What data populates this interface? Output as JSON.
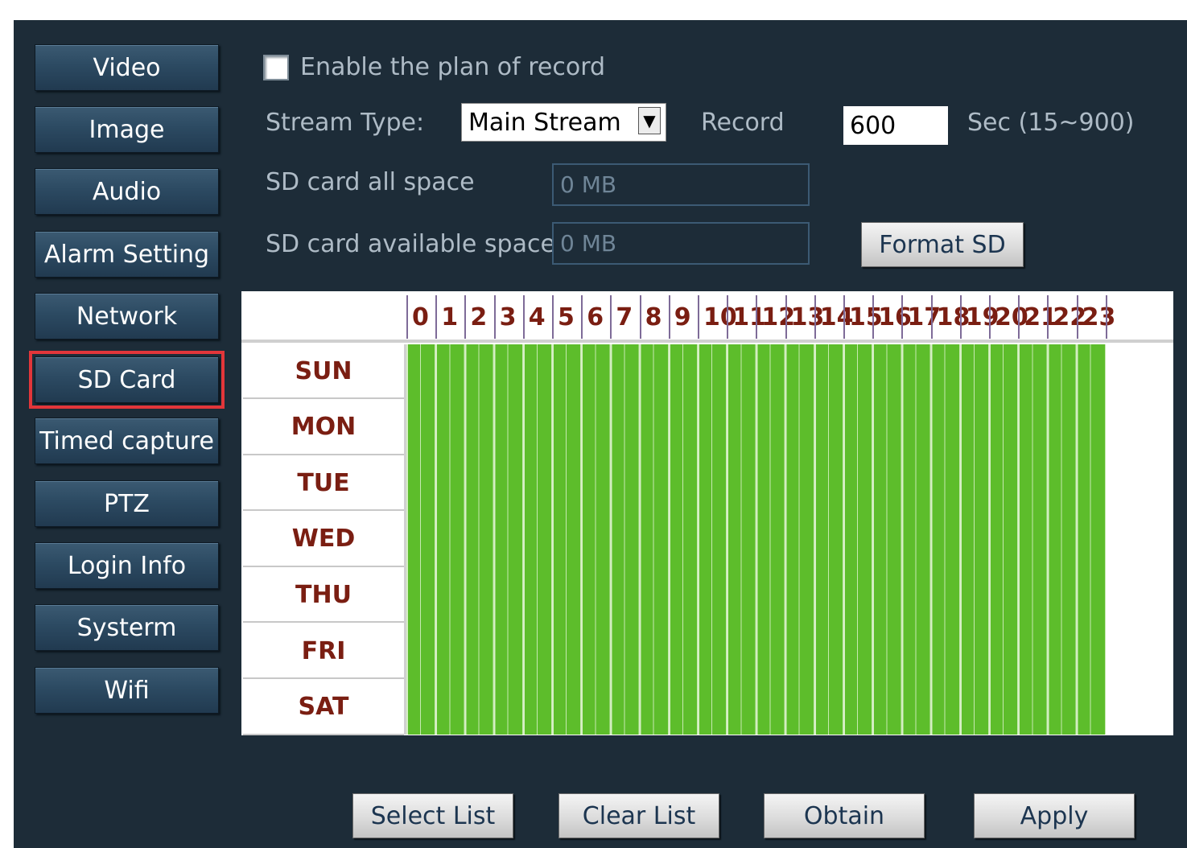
{
  "sidebar": {
    "items": [
      {
        "label": "Video"
      },
      {
        "label": "Image"
      },
      {
        "label": "Audio"
      },
      {
        "label": "Alarm Setting"
      },
      {
        "label": "Network"
      },
      {
        "label": "SD Card",
        "active": true
      },
      {
        "label": "Timed capture"
      },
      {
        "label": "PTZ"
      },
      {
        "label": "Login Info"
      },
      {
        "label": "Systerm"
      },
      {
        "label": "Wifi"
      }
    ]
  },
  "record": {
    "enable_label": "Enable the plan of record",
    "enabled": false,
    "stream_type_label": "Stream Type:",
    "stream_type_value": "Main Stream",
    "record_label": "Record",
    "record_value": "600",
    "record_unit": "Sec (15~900)"
  },
  "sd": {
    "all_space_label": "SD card all space",
    "all_space_value": "0 MB",
    "available_label": "SD card available space",
    "available_value": "0 MB",
    "format_button": "Format SD"
  },
  "schedule": {
    "hours": [
      "0",
      "1",
      "2",
      "3",
      "4",
      "5",
      "6",
      "7",
      "8",
      "9",
      "10",
      "11",
      "12",
      "13",
      "14",
      "15",
      "16",
      "17",
      "18",
      "19",
      "20",
      "21",
      "22",
      "23"
    ],
    "days": [
      "SUN",
      "MON",
      "TUE",
      "WED",
      "THU",
      "FRI",
      "SAT"
    ],
    "all_selected": true
  },
  "actions": {
    "select_list": "Select List",
    "clear_list": "Clear List",
    "obtain": "Obtain",
    "apply": "Apply"
  },
  "colors": {
    "panel_bg": "#1d2c38",
    "selected_cell": "#5dbd2b",
    "active_outline": "#e2363a",
    "header_text": "#7a1e12"
  }
}
